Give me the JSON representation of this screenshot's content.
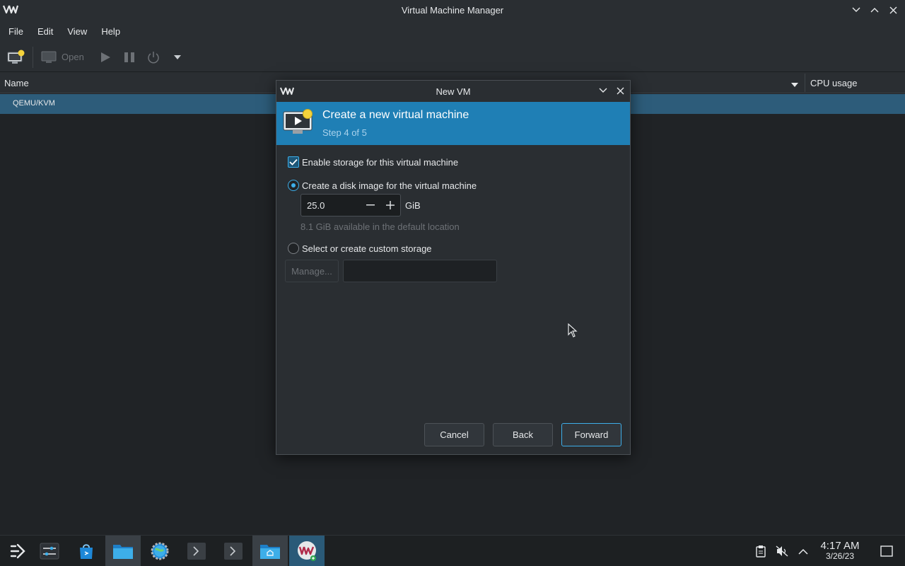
{
  "window": {
    "title": "Virtual Machine Manager"
  },
  "menubar": {
    "items": [
      "File",
      "Edit",
      "View",
      "Help"
    ]
  },
  "toolbar": {
    "open_label": "Open"
  },
  "columns": {
    "name": "Name",
    "cpu": "CPU usage"
  },
  "connections": [
    {
      "label": "QEMU/KVM"
    }
  ],
  "dialog": {
    "title": "New VM",
    "banner_title": "Create a new virtual machine",
    "banner_step": "Step 4 of 5",
    "enable_storage_label": "Enable storage for this virtual machine",
    "enable_storage_checked": true,
    "create_disk_label": "Create a disk image for the virtual machine",
    "disk_size_value": "25.0",
    "disk_size_unit": "GiB",
    "available_text": "8.1 GiB available in the default location",
    "custom_storage_label": "Select or create custom storage",
    "manage_label": "Manage...",
    "cancel_label": "Cancel",
    "back_label": "Back",
    "forward_label": "Forward",
    "selected_option": "create_disk"
  },
  "taskbar": {
    "time": "4:17 AM",
    "date": "3/26/23"
  },
  "colors": {
    "accent": "#3daee9",
    "banner": "#1f7fb5",
    "selection": "#2d5c7a",
    "background": "#202326"
  }
}
